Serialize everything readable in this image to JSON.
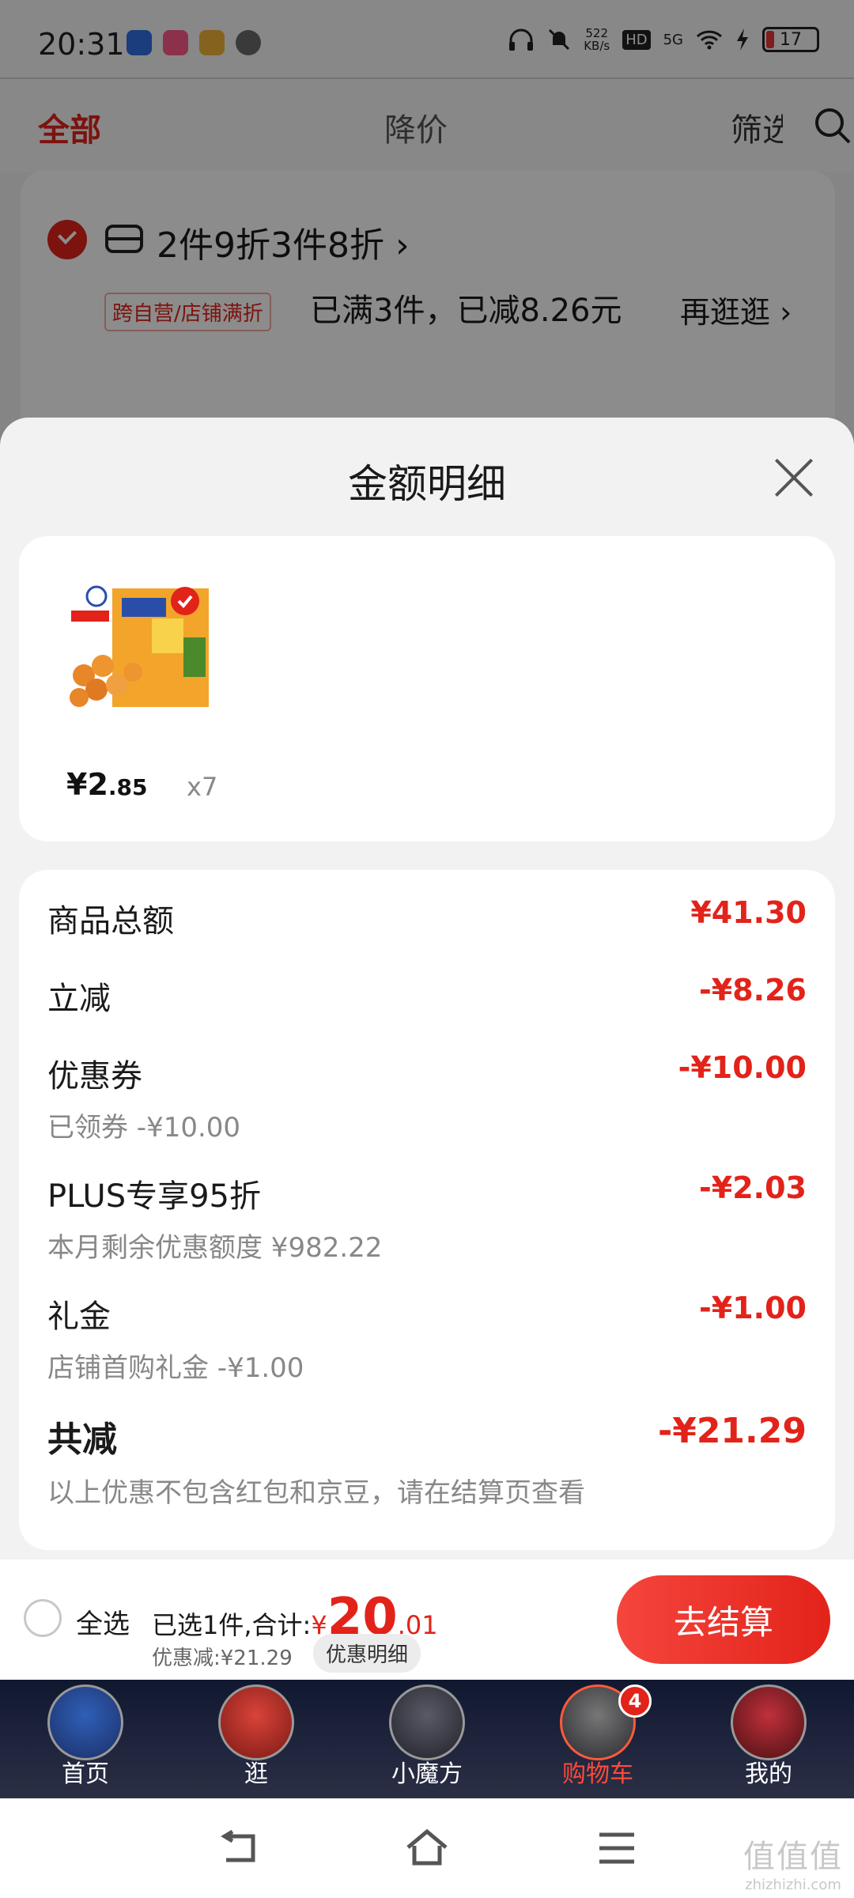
{
  "status": {
    "time": "20:31",
    "net_speed_value": "522",
    "net_speed_unit": "KB/s",
    "hd": "HD",
    "signal": "5G",
    "battery": "17"
  },
  "top_nav": {
    "tab_all": "全部",
    "tab_price_drop": "降价",
    "tab_filter": "筛选"
  },
  "promo": {
    "title": "2件9折3件8折 ›",
    "tag": "跨自营/店铺满折",
    "desc": "已满3件，已减8.26元",
    "more": "再逛逛 ›"
  },
  "sheet": {
    "title": "金额明细",
    "item": {
      "price_int": "¥2",
      "price_dec": ".85",
      "qty": "x7"
    },
    "rows": [
      {
        "label": "商品总额",
        "sub": "",
        "value": "¥41.30"
      },
      {
        "label": "立减",
        "sub": "",
        "value": "-¥8.26"
      },
      {
        "label": "优惠券",
        "sub": "已领券 -¥10.00",
        "value": "-¥10.00"
      },
      {
        "label": "PLUS专享95折",
        "sub": "本月剩余优惠额度 ¥982.22",
        "value": "-¥2.03"
      },
      {
        "label": "礼金",
        "sub": "店铺首购礼金 -¥1.00",
        "value": "-¥1.00"
      }
    ],
    "total": {
      "label": "共减",
      "value": "-¥21.29",
      "note": "以上优惠不包含红包和京豆，请在结算页查看"
    }
  },
  "checkout": {
    "select_all": "全选",
    "summary_prefix": "已选1件,合计:",
    "yen": "¥",
    "total_int": "20",
    "total_dec": ".01",
    "saved": "优惠减:¥21.29",
    "detail_link": "优惠明细",
    "pay_button": "去结算"
  },
  "tabbar": {
    "items": [
      {
        "label": "首页",
        "icon": "captain-america-avatar-icon"
      },
      {
        "label": "逛",
        "icon": "iron-man-avatar-icon"
      },
      {
        "label": "小魔方",
        "icon": "thor-avatar-icon"
      },
      {
        "label": "购物车",
        "icon": "war-machine-avatar-icon",
        "badge": "4",
        "active": true
      },
      {
        "label": "我的",
        "icon": "ant-man-avatar-icon"
      }
    ]
  },
  "watermark": {
    "big": "值值值",
    "small": "zhizhizhi.com"
  },
  "colors": {
    "accent_red": "#e2231a",
    "tabbar_bg": "#1b2136"
  }
}
